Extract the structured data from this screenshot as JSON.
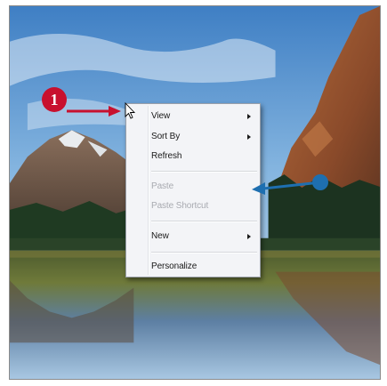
{
  "callout": {
    "number": "1"
  },
  "context_menu": {
    "items": [
      {
        "label": "View"
      },
      {
        "label": "Sort By"
      },
      {
        "label": "Refresh"
      },
      {
        "label": "Paste"
      },
      {
        "label": "Paste Shortcut"
      },
      {
        "label": "New"
      },
      {
        "label": "Personalize"
      }
    ]
  },
  "colors": {
    "callout_red": "#c8102e",
    "pointer_blue": "#1e6fb0",
    "menu_background": "#f3f4f7",
    "disabled_text": "#a8aab0"
  },
  "icons": [
    "mouse-cursor-icon",
    "submenu-arrow-icon"
  ]
}
